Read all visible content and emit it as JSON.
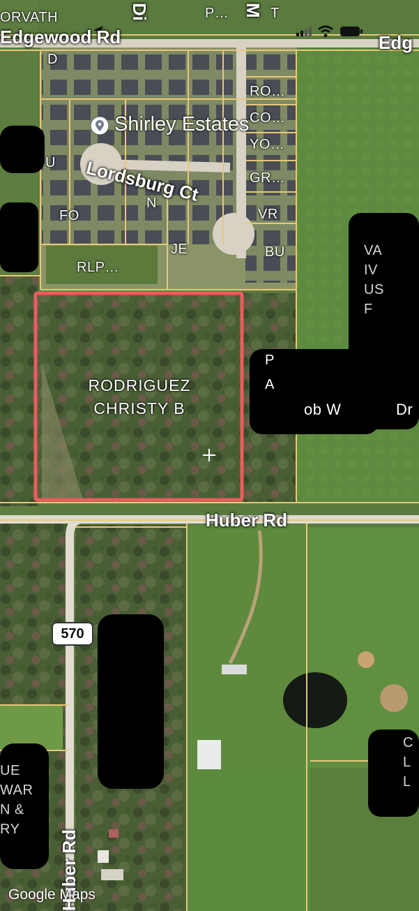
{
  "status_bar": {
    "signal_icon": "cellular-signal-icon",
    "wifi_icon": "wifi-icon",
    "battery_icon": "battery-icon",
    "location_icon": "location-arrow-icon"
  },
  "roads": {
    "edgewood_left": "Edgewood Rd",
    "edgewood_right": "Edg",
    "lordsburg": "Lordsburg Ct",
    "huber_horizontal": "Huber Rd",
    "huber_vertical": "Huber Rd",
    "route_shield": "570",
    "top_partial_1": "Di",
    "top_partial_2": "M"
  },
  "place": {
    "name": "Shirley Estates",
    "pin_icon": "place-pin-icon"
  },
  "selected_parcel": {
    "owner_line1": "RODRIGUEZ",
    "owner_line2": "CHRISTY B",
    "border_color": "#e85d5d"
  },
  "parcel_labels": {
    "horvath": "ORVATH",
    "p": "P…",
    "t": "T",
    "d": "D",
    "u": "U",
    "fo": "FO",
    "n": "N",
    "je": "JE",
    "rlp": "RLP…",
    "ro": "RO…",
    "co": "CO…",
    "yo": "YO…",
    "gr": "GR…",
    "vr": "VR",
    "bu": "BU",
    "partial_a": "P",
    "partial_b": "A",
    "partial_c": "ob W",
    "partial_d": "Dr",
    "right_side": "VA\nIV\nUS\nF",
    "bottom_left": "UE\nWAR\nN &\nRY",
    "bottom_right": "C\nL\nL"
  },
  "watermark": "Google Maps",
  "colors": {
    "parcel_line": "#e8c877",
    "road": "#d8d2c4",
    "highlight": "#e85d5d"
  }
}
